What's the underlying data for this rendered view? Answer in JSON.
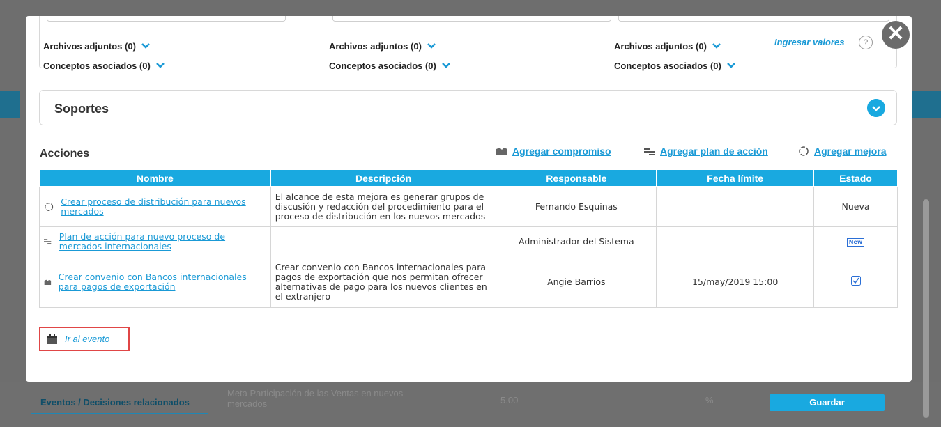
{
  "top_panel": {
    "columns": [
      {
        "attachments": "Archivos adjuntos (0)",
        "concepts": "Conceptos asociados (0)"
      },
      {
        "attachments": "Archivos adjuntos (0)",
        "concepts": "Conceptos asociados (0)"
      },
      {
        "attachments": "Archivos adjuntos (0)",
        "concepts": "Conceptos asociados (0)"
      }
    ],
    "ingresar_valores": "Ingresar valores",
    "help_symbol": "?"
  },
  "close_symbol": "✕",
  "soportes": {
    "title": "Soportes"
  },
  "acciones": {
    "title": "Acciones",
    "links": {
      "compromiso": "Agregar compromiso",
      "plan": "Agregar plan de acción",
      "mejora": "Agregar mejora"
    }
  },
  "table": {
    "headers": [
      "Nombre",
      "Descripción",
      "Responsable",
      "Fecha límite",
      "Estado"
    ],
    "rows": [
      {
        "icon": "improvement-icon",
        "name": "Crear proceso de distribución para nuevos mercados",
        "description": "El alcance de esta mejora es generar grupos de discusión y redacción del procedimiento para el proceso de distribución en los nuevos mercados",
        "responsable": "Fernando Esquinas",
        "fecha": "",
        "estado": "Nueva"
      },
      {
        "icon": "action-plan-icon",
        "name": "Plan de acción para nuevo proceso de mercados internacionales",
        "description": "",
        "responsable": "Administrador del Sistema",
        "fecha": "",
        "estado": "New"
      },
      {
        "icon": "commitment-icon",
        "name": "Crear convenio con Bancos internacionales para pagos de exportación",
        "description": "Crear convenio con Bancos internacionales para pagos de exportación que nos permitan ofrecer alternativas de pago para los nuevos clientes en el extranjero",
        "responsable": "Angie Barrios",
        "fecha": "15/may/2019 15:00",
        "estado": "checked"
      }
    ]
  },
  "ir_al_evento": "Ir al evento",
  "background": {
    "tab_label": "Eventos / Decisiones relacionados",
    "ghost_text": "Meta Participación de las Ventas en nuevos mercados",
    "ghost_value": "5.00",
    "ghost_pct": "%",
    "save_label": "Guardar"
  },
  "colors": {
    "accent": "#19a9e0",
    "link": "#1a9ad6",
    "highlight": "#e04646"
  }
}
